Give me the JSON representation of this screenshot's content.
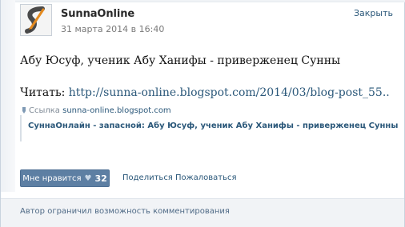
{
  "post": {
    "author": "SunnaOnline",
    "date": "31 марта 2014 в 16:40",
    "close_label": "Закрыть",
    "title": "Абу Юсуф, ученик Абу Ханифы - приверженец Сунны",
    "read_label": "Читать: ",
    "url": "http://sunna-online.blogspot.com/2014/03/blog-post_55.."
  },
  "attachment": {
    "prefix": "Ссылка",
    "domain": "sunna-online.blogspot.com",
    "title": "СуннаОнлайн - запасной: Абу Юсуф, ученик Абу Ханифы - приверженец Сунны"
  },
  "actions": {
    "like_label": "Мне нравится",
    "like_count": "32",
    "share_label": "Поделиться",
    "report_label": "Пожаловаться"
  },
  "footer": {
    "text": "Автор ограничил возможность комментирования"
  },
  "colors": {
    "link": "#2b587a",
    "button": "#5d7fa3"
  }
}
